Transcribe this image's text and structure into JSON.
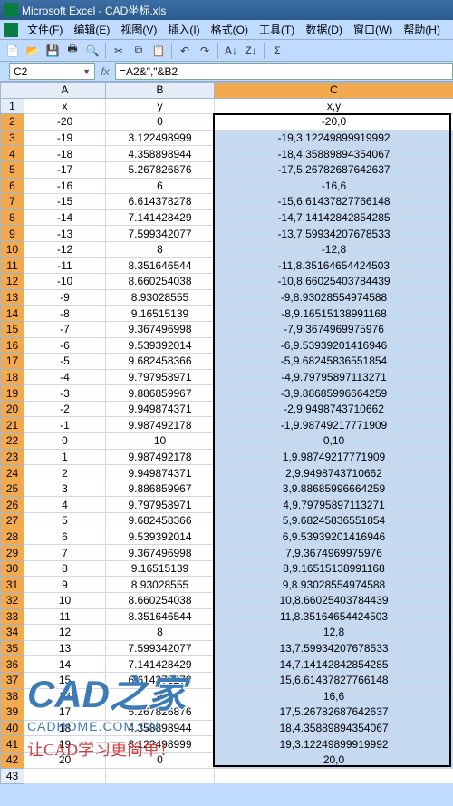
{
  "window": {
    "title": "Microsoft Excel - CAD坐标.xls"
  },
  "menu": {
    "items": [
      "文件(F)",
      "编辑(E)",
      "视图(V)",
      "插入(I)",
      "格式(O)",
      "工具(T)",
      "数据(D)",
      "窗口(W)",
      "帮助(H)"
    ]
  },
  "formula_bar": {
    "name_box": "C2",
    "fx": "fx",
    "formula": "=A2&\",\"&B2"
  },
  "columns": [
    "A",
    "B",
    "C"
  ],
  "headers": {
    "A": "x",
    "B": "y",
    "C": "x,y"
  },
  "rows": [
    {
      "n": 1,
      "A": "x",
      "B": "y",
      "C": "x,y"
    },
    {
      "n": 2,
      "A": "-20",
      "B": "0",
      "C": "-20,0"
    },
    {
      "n": 3,
      "A": "-19",
      "B": "3.122498999",
      "C": "-19,3.12249899919992"
    },
    {
      "n": 4,
      "A": "-18",
      "B": "4.358898944",
      "C": "-18,4.35889894354067"
    },
    {
      "n": 5,
      "A": "-17",
      "B": "5.267826876",
      "C": "-17,5.26782687642637"
    },
    {
      "n": 6,
      "A": "-16",
      "B": "6",
      "C": "-16,6"
    },
    {
      "n": 7,
      "A": "-15",
      "B": "6.614378278",
      "C": "-15,6.61437827766148"
    },
    {
      "n": 8,
      "A": "-14",
      "B": "7.141428429",
      "C": "-14,7.14142842854285"
    },
    {
      "n": 9,
      "A": "-13",
      "B": "7.599342077",
      "C": "-13,7.59934207678533"
    },
    {
      "n": 10,
      "A": "-12",
      "B": "8",
      "C": "-12,8"
    },
    {
      "n": 11,
      "A": "-11",
      "B": "8.351646544",
      "C": "-11,8.35164654424503"
    },
    {
      "n": 12,
      "A": "-10",
      "B": "8.660254038",
      "C": "-10,8.66025403784439"
    },
    {
      "n": 13,
      "A": "-9",
      "B": "8.93028555",
      "C": "-9,8.93028554974588"
    },
    {
      "n": 14,
      "A": "-8",
      "B": "9.16515139",
      "C": "-8,9.16515138991168"
    },
    {
      "n": 15,
      "A": "-7",
      "B": "9.367496998",
      "C": "-7,9.3674969975976"
    },
    {
      "n": 16,
      "A": "-6",
      "B": "9.539392014",
      "C": "-6,9.53939201416946"
    },
    {
      "n": 17,
      "A": "-5",
      "B": "9.682458366",
      "C": "-5,9.68245836551854"
    },
    {
      "n": 18,
      "A": "-4",
      "B": "9.797958971",
      "C": "-4,9.79795897113271"
    },
    {
      "n": 19,
      "A": "-3",
      "B": "9.886859967",
      "C": "-3,9.88685996664259"
    },
    {
      "n": 20,
      "A": "-2",
      "B": "9.949874371",
      "C": "-2,9.9498743710662"
    },
    {
      "n": 21,
      "A": "-1",
      "B": "9.987492178",
      "C": "-1,9.98749217771909"
    },
    {
      "n": 22,
      "A": "0",
      "B": "10",
      "C": "0,10"
    },
    {
      "n": 23,
      "A": "1",
      "B": "9.987492178",
      "C": "1,9.98749217771909"
    },
    {
      "n": 24,
      "A": "2",
      "B": "9.949874371",
      "C": "2,9.9498743710662"
    },
    {
      "n": 25,
      "A": "3",
      "B": "9.886859967",
      "C": "3,9.88685996664259"
    },
    {
      "n": 26,
      "A": "4",
      "B": "9.797958971",
      "C": "4,9.79795897113271"
    },
    {
      "n": 27,
      "A": "5",
      "B": "9.682458366",
      "C": "5,9.68245836551854"
    },
    {
      "n": 28,
      "A": "6",
      "B": "9.539392014",
      "C": "6,9.53939201416946"
    },
    {
      "n": 29,
      "A": "7",
      "B": "9.367496998",
      "C": "7,9.3674969975976"
    },
    {
      "n": 30,
      "A": "8",
      "B": "9.16515139",
      "C": "8,9.16515138991168"
    },
    {
      "n": 31,
      "A": "9",
      "B": "8.93028555",
      "C": "9,8.93028554974588"
    },
    {
      "n": 32,
      "A": "10",
      "B": "8.660254038",
      "C": "10,8.66025403784439"
    },
    {
      "n": 33,
      "A": "11",
      "B": "8.351646544",
      "C": "11,8.35164654424503"
    },
    {
      "n": 34,
      "A": "12",
      "B": "8",
      "C": "12,8"
    },
    {
      "n": 35,
      "A": "13",
      "B": "7.599342077",
      "C": "13,7.59934207678533"
    },
    {
      "n": 36,
      "A": "14",
      "B": "7.141428429",
      "C": "14,7.14142842854285"
    },
    {
      "n": 37,
      "A": "15",
      "B": "6.614378278",
      "C": "15,6.61437827766148"
    },
    {
      "n": 38,
      "A": "16",
      "B": "6",
      "C": "16,6"
    },
    {
      "n": 39,
      "A": "17",
      "B": "5.267826876",
      "C": "17,5.26782687642637"
    },
    {
      "n": 40,
      "A": "18",
      "B": "4.358898944",
      "C": "18,4.35889894354067"
    },
    {
      "n": 41,
      "A": "19",
      "B": "3.122498999",
      "C": "19,3.12249899919992"
    },
    {
      "n": 42,
      "A": "20",
      "B": "0",
      "C": "20,0"
    },
    {
      "n": 43,
      "A": "",
      "B": "",
      "C": ""
    }
  ],
  "watermark": {
    "main": "CAD之家",
    "url": "CADHOME.COM.CN",
    "slogan": "让CAD学习更简单！"
  }
}
